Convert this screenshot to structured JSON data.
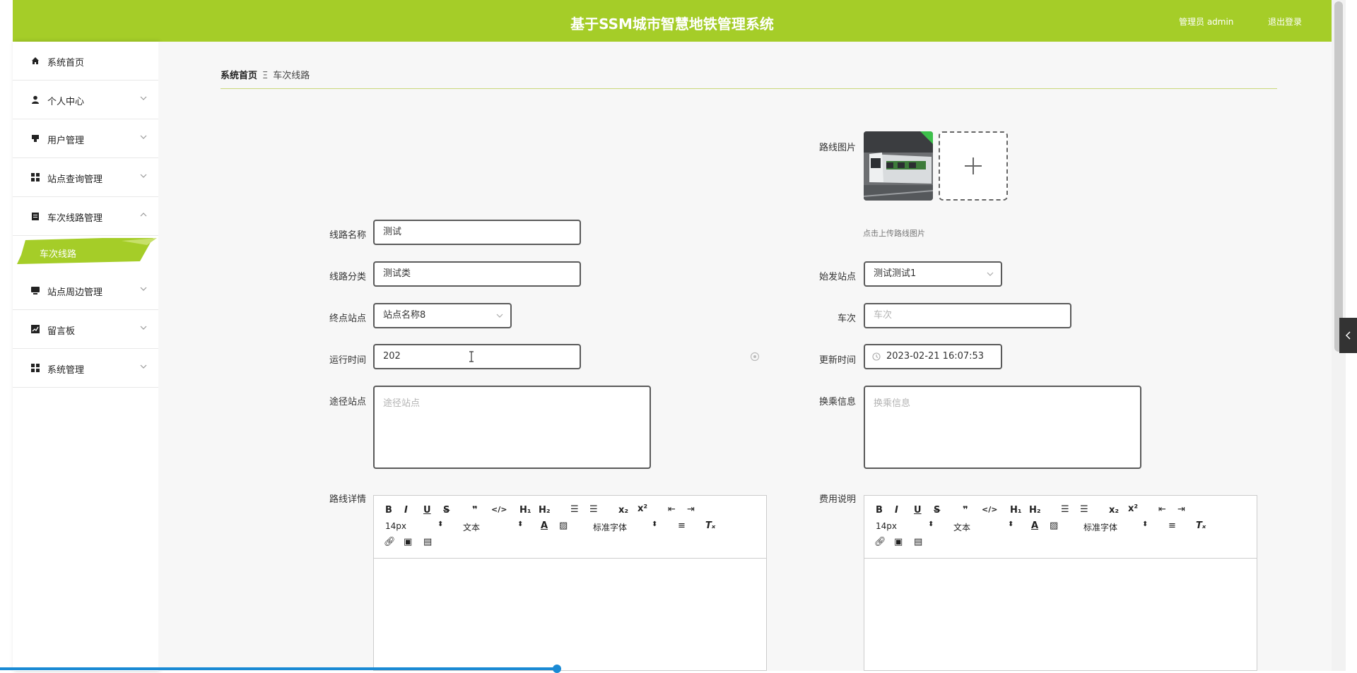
{
  "header": {
    "title": "基于SSM城市智慧地铁管理系统",
    "admin_label": "管理员 admin",
    "logout_label": "退出登录"
  },
  "sidebar": {
    "items": [
      {
        "label": "系统首页",
        "icon": "home-icon"
      },
      {
        "label": "个人中心",
        "icon": "person-icon"
      },
      {
        "label": "用户管理",
        "icon": "user-icon"
      },
      {
        "label": "站点查询管理",
        "icon": "grid-icon"
      },
      {
        "label": "车次线路管理",
        "icon": "clipboard-icon"
      },
      {
        "label": "站点周边管理",
        "icon": "monitor-icon"
      },
      {
        "label": "留言板",
        "icon": "chart-icon"
      },
      {
        "label": "系统管理",
        "icon": "grid-icon"
      }
    ],
    "active_sub": "车次线路"
  },
  "breadcrumb": {
    "home": "系统首页",
    "separator": "Ξ",
    "current": "车次线路"
  },
  "form": {
    "route_image_label": "路线图片",
    "upload_tip": "点击上传路线图片",
    "route_name_label": "线路名称",
    "route_name": "测试",
    "route_category_label": "线路分类",
    "route_category": "测试类",
    "start_station_label": "始发站点",
    "start_station": "测试测试1",
    "end_station_label": "终点站点",
    "end_station": "站点名称8",
    "train_no_label": "车次",
    "train_no_placeholder": "车次",
    "run_time_label": "运行时间",
    "run_time": "202",
    "update_time_label": "更新时间",
    "update_time": "2023-02-21 16:07:53",
    "via_stations_label": "途径站点",
    "via_stations_placeholder": "途径站点",
    "transfer_label": "换乘信息",
    "transfer_placeholder": "换乘信息",
    "route_detail_label": "路线详情",
    "fee_label": "费用说明"
  },
  "editor": {
    "font_size": "14px",
    "text_type": "文本",
    "font_family": "标准字体"
  },
  "colors": {
    "accent": "#a5cd28",
    "scroll_progress": "#1a8ad4"
  }
}
